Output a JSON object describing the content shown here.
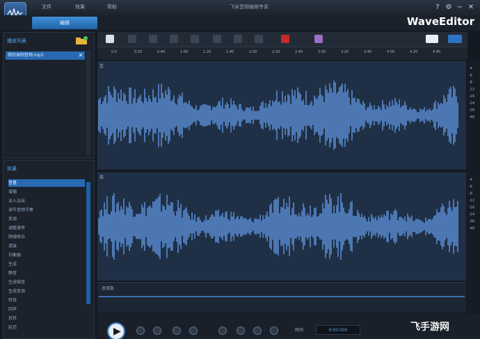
{
  "titlebar": {
    "menus": [
      "文件",
      "效果",
      "帮助"
    ],
    "title": "飞米音频编辑专家",
    "buttons": [
      "?",
      "⚙",
      "−",
      "□",
      "✕"
    ]
  },
  "tabs": {
    "active": "编辑"
  },
  "brand": "WaveEditor",
  "file_panel": {
    "title": "播放列表",
    "file_name": "我的录制音频.mp3",
    "close": "✕"
  },
  "effect_panel": {
    "title": "效果",
    "items": [
      {
        "label": "音量",
        "selected": true
      },
      {
        "label": "增幅",
        "selected": false
      },
      {
        "label": "淡入淡出",
        "selected": false
      },
      {
        "label": "调节音频节奏",
        "selected": false
      },
      {
        "label": "变调",
        "selected": false
      },
      {
        "label": "调整速率",
        "selected": false
      },
      {
        "label": "降噪降杂",
        "selected": false
      },
      {
        "label": "滤波",
        "selected": false
      },
      {
        "label": "均衡器",
        "selected": false
      },
      {
        "label": "生成",
        "selected": false
      },
      {
        "label": "静音",
        "selected": false
      },
      {
        "label": "生成噪音",
        "selected": false
      },
      {
        "label": "生成音调",
        "selected": false
      },
      {
        "label": "特效",
        "selected": false
      },
      {
        "label": "回声",
        "selected": false
      },
      {
        "label": "反转",
        "selected": false
      },
      {
        "label": "延迟",
        "selected": false
      }
    ]
  },
  "ruler": {
    "ticks": [
      "0.0",
      "0.20",
      "0.40",
      "1.00",
      "1.20",
      "1.40",
      "2.00",
      "2.20",
      "2.40",
      "3.00",
      "3.20",
      "3.40",
      "4.00",
      "4.20",
      "4.40"
    ]
  },
  "tracks": {
    "left_name": "左",
    "right_name": "右",
    "db_scale": [
      "-4",
      "-6",
      "-8",
      "-12",
      "-16",
      "-24",
      "-36",
      "-48"
    ]
  },
  "overview": {
    "label": "总览轨"
  },
  "transport": {
    "time_label": "时间",
    "time_value": "0:00.000",
    "play_icon": "▶"
  },
  "watermark": "飞手游网",
  "colors": {
    "accent": "#2869b2",
    "waveform": "#5b8fd6",
    "track_bg": "#1f3046",
    "app_bg": "#141a22"
  }
}
